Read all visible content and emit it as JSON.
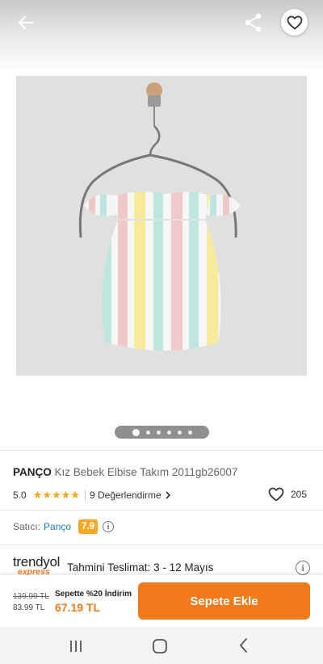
{
  "header": {
    "back_icon": "arrow-left-icon",
    "share_icon": "share-icon",
    "favorite_icon": "heart-outline-icon"
  },
  "gallery": {
    "image_alt": "Kız Bebek Elbise Takım",
    "dot_count": 6,
    "active_index": 0
  },
  "product": {
    "brand": "PANÇO",
    "name": "Kız Bebek Elbise Takım 2011gb26007",
    "rating": "5.0",
    "stars": "★★★★★",
    "rating_stars_value": 5,
    "reviews_label": "9 Değerlendirme",
    "favorite_count": "205"
  },
  "seller": {
    "label": "Satıcı:",
    "name": "Panço",
    "score": "7.9"
  },
  "delivery": {
    "logo_main": "trendyol",
    "logo_sub": "express",
    "label": "Tahmini Teslimat:",
    "dates": "3 - 12 Mayıs"
  },
  "pricing": {
    "old_price": "139.99 TL",
    "price": "83.99 TL",
    "discount_label": "Sepette %20 İndirim",
    "final_price": "67.19 TL",
    "cart_button": "Sepete Ekle"
  },
  "colors": {
    "accent": "#f27a1a",
    "seller_link": "#1a7cd6",
    "score_badge": "#f9a825",
    "star": "#f5a623"
  }
}
